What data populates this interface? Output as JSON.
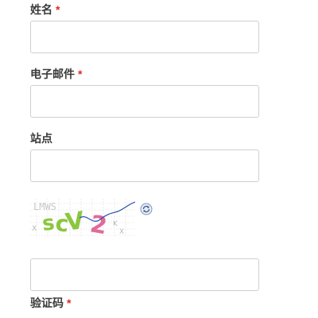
{
  "form": {
    "name": {
      "label": "姓名",
      "required_mark": "*",
      "value": ""
    },
    "email": {
      "label": "电子邮件",
      "required_mark": "*",
      "value": ""
    },
    "website": {
      "label": "站点",
      "value": ""
    },
    "captcha": {
      "image_text": "scV2",
      "noise_text": "LMWS",
      "refresh_icon": "refresh-icon",
      "value": "",
      "label": "验证码",
      "required_mark": "*"
    }
  },
  "colors": {
    "required": "#e0262b",
    "field_border": "#cfcfcf",
    "captcha_green": "#8cc63f",
    "captcha_pink": "#e06a9a",
    "captcha_line": "#2a4fb0"
  }
}
